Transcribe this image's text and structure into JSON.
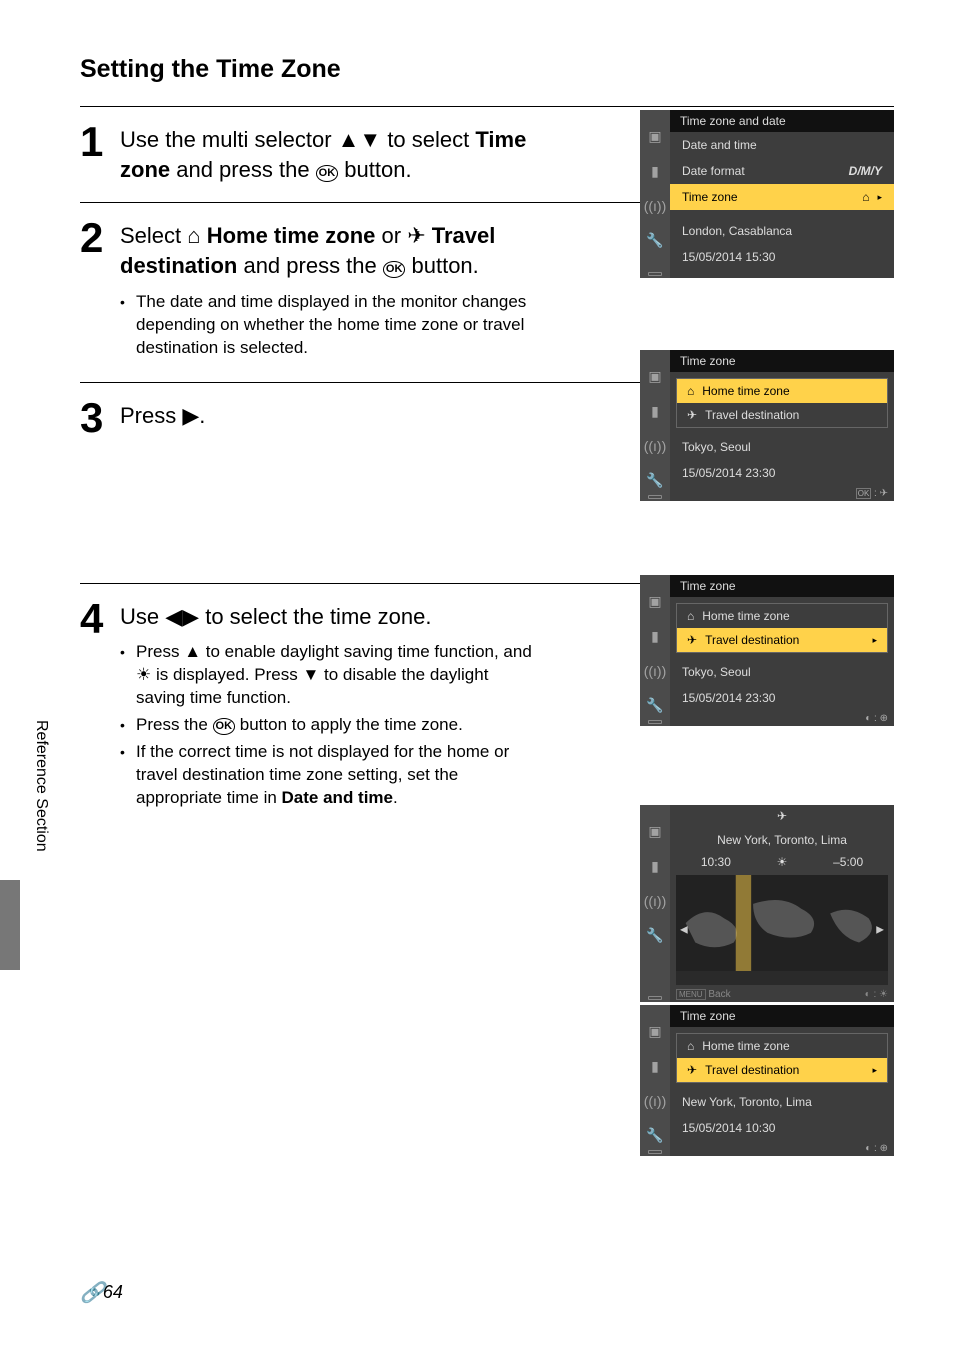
{
  "page": {
    "title": "Setting the Time Zone",
    "sidebar_label": "Reference Section",
    "page_number": "64"
  },
  "steps": {
    "s1": {
      "num": "1",
      "text_a": "Use the multi selector ",
      "text_b": " to select ",
      "bold1": "Time zone",
      "text_c": " and press the ",
      "text_d": " button."
    },
    "s2": {
      "num": "2",
      "text_a": "Select ",
      "bold1": "Home time zone",
      "text_b": " or ",
      "bold2": "Travel destination",
      "text_c": " and press the ",
      "text_d": " button.",
      "detail1": "The date and time displayed in the monitor changes depending on whether the home time zone or travel destination is selected."
    },
    "s3": {
      "num": "3",
      "text_a": "Press ",
      "text_b": "."
    },
    "s4": {
      "num": "4",
      "text_a": "Use ",
      "text_b": " to select the time zone.",
      "d1_a": "Press ",
      "d1_b": " to enable daylight saving time function, and ",
      "d1_c": " is displayed. Press ",
      "d1_d": " to disable the daylight saving time function.",
      "d2_a": "Press the ",
      "d2_b": " button to apply the time zone.",
      "d3_a": "If the correct time is not displayed for the home or travel destination time zone setting, set the appropriate time in ",
      "d3_bold": "Date and time",
      "d3_b": "."
    }
  },
  "lcd1": {
    "title": "Time zone and date",
    "r1": "Date and time",
    "r2": "Date format",
    "r2v": "D/M/Y",
    "r3": "Time zone",
    "loc": "London, Casablanca",
    "dt": "15/05/2014  15:30"
  },
  "lcd2": {
    "title": "Time zone",
    "opt1": "Home time zone",
    "opt2": "Travel destination",
    "loc": "Tokyo, Seoul",
    "dt": "15/05/2014  23:30"
  },
  "lcd3": {
    "title": "Time zone",
    "opt1": "Home time zone",
    "opt2": "Travel destination",
    "loc": "Tokyo, Seoul",
    "dt": "15/05/2014  23:30"
  },
  "lcd4": {
    "loc": "New York, Toronto, Lima",
    "time": "10:30",
    "offset": "–5:00",
    "back": "Back"
  },
  "lcd5": {
    "title": "Time zone",
    "opt1": "Home time zone",
    "opt2": "Travel destination",
    "loc": "New York, Toronto, Lima",
    "dt": "15/05/2014  10:30"
  }
}
